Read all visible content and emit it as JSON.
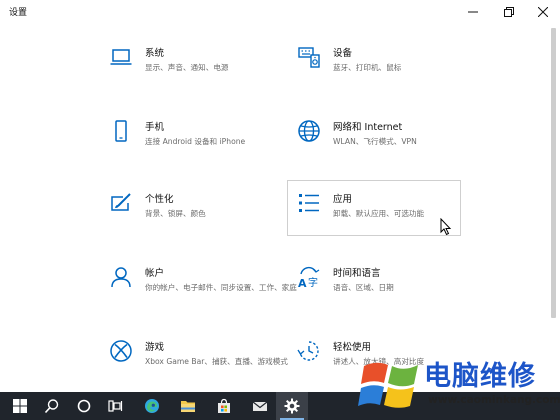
{
  "window": {
    "title": "设置"
  },
  "categories": [
    {
      "id": "system",
      "icon": "laptop-icon",
      "title": "系统",
      "desc": "显示、声音、通知、电源"
    },
    {
      "id": "devices",
      "icon": "keyboard-speaker-icon",
      "title": "设备",
      "desc": "蓝牙、打印机、鼠标"
    },
    {
      "id": "phone",
      "icon": "phone-icon",
      "title": "手机",
      "desc": "连接 Android 设备和 iPhone"
    },
    {
      "id": "network",
      "icon": "globe-icon",
      "title": "网络和 Internet",
      "desc": "WLAN、飞行模式、VPN"
    },
    {
      "id": "personalization",
      "icon": "paintbrush-icon",
      "title": "个性化",
      "desc": "背景、锁屏、颜色"
    },
    {
      "id": "apps",
      "icon": "apps-list-icon",
      "title": "应用",
      "desc": "卸载、默认应用、可选功能"
    },
    {
      "id": "accounts",
      "icon": "person-icon",
      "title": "帐户",
      "desc": "你的帐户、电子邮件、同步设置、工作、家庭"
    },
    {
      "id": "time-language",
      "icon": "time-language-icon",
      "title": "时间和语言",
      "desc": "语音、区域、日期"
    },
    {
      "id": "gaming",
      "icon": "xbox-icon",
      "title": "游戏",
      "desc": "Xbox Game Bar、捕获、直播、游戏模式"
    },
    {
      "id": "ease-of-access",
      "icon": "ease-of-access-icon",
      "title": "轻松使用",
      "desc": "讲述人、放大镜、高对比度"
    }
  ],
  "watermark": {
    "text": "电脑维修",
    "url": "www.caominkang.com"
  },
  "colors": {
    "accent": "#0067c0",
    "taskbar": "#20252c",
    "watermark_blue": "#1d55c8"
  }
}
